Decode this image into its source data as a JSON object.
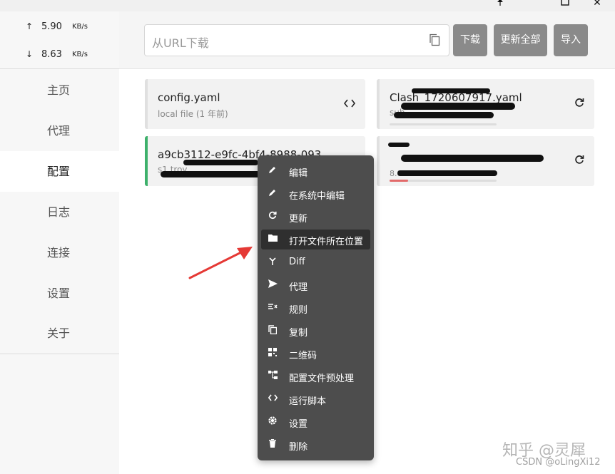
{
  "window": {
    "pin_icon": "pin-icon",
    "maximize_icon": "square-icon",
    "close_label": "✕"
  },
  "traffic": {
    "up": {
      "arrow": "↑",
      "value": "5.90",
      "unit": "KB/s"
    },
    "down": {
      "arrow": "↓",
      "value": "8.63",
      "unit": "KB/s"
    }
  },
  "sidebar": {
    "items": [
      {
        "label": "主页",
        "active": false
      },
      {
        "label": "代理",
        "active": false
      },
      {
        "label": "配置",
        "active": true
      },
      {
        "label": "日志",
        "active": false
      },
      {
        "label": "连接",
        "active": false
      },
      {
        "label": "设置",
        "active": false
      },
      {
        "label": "关于",
        "active": false
      }
    ]
  },
  "header": {
    "url_placeholder": "从URL下载",
    "download_label": "下载",
    "update_all_label": "更新全部",
    "import_label": "导入"
  },
  "profiles": [
    {
      "title": "config.yaml",
      "subtitle": "local file (1 年前)",
      "icon": "code-icon"
    },
    {
      "title": "Clash_1720607917.yaml",
      "subtitle": "sub",
      "icon": "refresh-icon"
    },
    {
      "title": "a9cb3112-e9fc-4bf4-8988-093...",
      "subtitle": "s1.troy",
      "icon": "",
      "selected": true
    },
    {
      "title": "",
      "subtitle": "8.8GB",
      "icon": "refresh-icon"
    }
  ],
  "context_menu": {
    "items": [
      {
        "label": "编辑",
        "icon": "pencil-icon"
      },
      {
        "label": "在系统中编辑",
        "icon": "pencil-icon"
      },
      {
        "label": "更新",
        "icon": "refresh-icon"
      },
      {
        "label": "打开文件所在位置",
        "icon": "folder-icon",
        "highlight": true
      },
      {
        "label": "Diff",
        "icon": "merge-icon"
      },
      {
        "label": "代理",
        "icon": "send-icon"
      },
      {
        "label": "规则",
        "icon": "rules-icon"
      },
      {
        "label": "复制",
        "icon": "copy-icon"
      },
      {
        "label": "二维码",
        "icon": "qrcode-icon"
      },
      {
        "label": "配置文件预处理",
        "icon": "tree-icon"
      },
      {
        "label": "运行脚本",
        "icon": "code-icon"
      },
      {
        "label": "设置",
        "icon": "gear-icon"
      },
      {
        "label": "删除",
        "icon": "trash-icon"
      }
    ]
  },
  "watermark": {
    "line1": "知乎 @灵犀",
    "line2": "CSDN @oLingXi12"
  },
  "colors": {
    "accent_green": "#3db06b",
    "button_gray": "#8a8a8a",
    "menu_bg": "#4d4d4d",
    "arrow_red": "#e53935"
  }
}
